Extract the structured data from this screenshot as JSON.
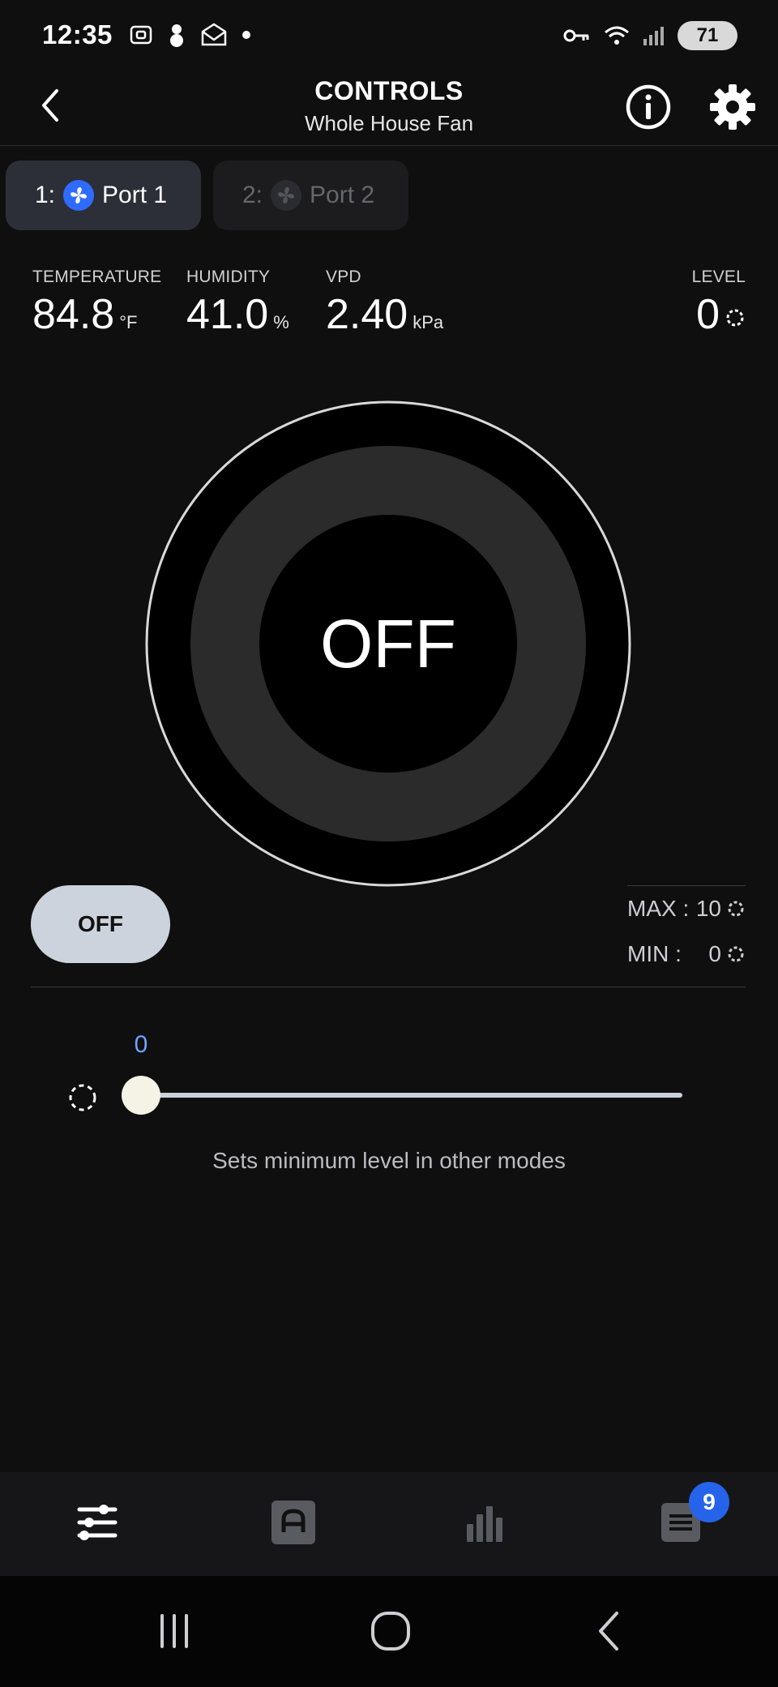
{
  "status_bar": {
    "time": "12:35",
    "battery_level": "71",
    "icons_left": [
      "screenshot-icon",
      "snowman-icon",
      "mail-icon",
      "dot-icon"
    ],
    "icons_right": [
      "key-icon",
      "wifi-icon",
      "signal-icon",
      "battery-icon"
    ]
  },
  "header": {
    "title": "CONTROLS",
    "subtitle": "Whole House Fan"
  },
  "ports": [
    {
      "number": "1:",
      "label": "Port 1",
      "active": true
    },
    {
      "number": "2:",
      "label": "Port 2",
      "active": false
    }
  ],
  "readings": {
    "temperature": {
      "label": "TEMPERATURE",
      "value": "84.8",
      "unit": "°F"
    },
    "humidity": {
      "label": "HUMIDITY",
      "value": "41.0",
      "unit": "%"
    },
    "vpd": {
      "label": "VPD",
      "value": "2.40",
      "unit": "kPa"
    },
    "level": {
      "label": "LEVEL",
      "value": "0"
    }
  },
  "dial": {
    "state_text": "OFF",
    "level": 0
  },
  "mode_button": {
    "label": "OFF"
  },
  "limits": {
    "max_label": "MAX :",
    "max_value": "10",
    "min_label": "MIN :",
    "min_value": "0"
  },
  "slider": {
    "value": "0",
    "hint": "Sets minimum level in other modes",
    "fraction": 0
  },
  "tabs": [
    {
      "name": "controls",
      "icon": "sliders-icon",
      "active": true
    },
    {
      "name": "automation",
      "icon": "automation-icon",
      "active": false
    },
    {
      "name": "data",
      "icon": "bar-chart-icon",
      "active": false
    },
    {
      "name": "log",
      "icon": "notes-icon",
      "active": false
    }
  ],
  "notification_badge": "9",
  "colors": {
    "background": "#0f0f10",
    "accent_blue": "#2f6bff",
    "slider_value": "#6ea3ff",
    "badge": "#2563eb"
  }
}
